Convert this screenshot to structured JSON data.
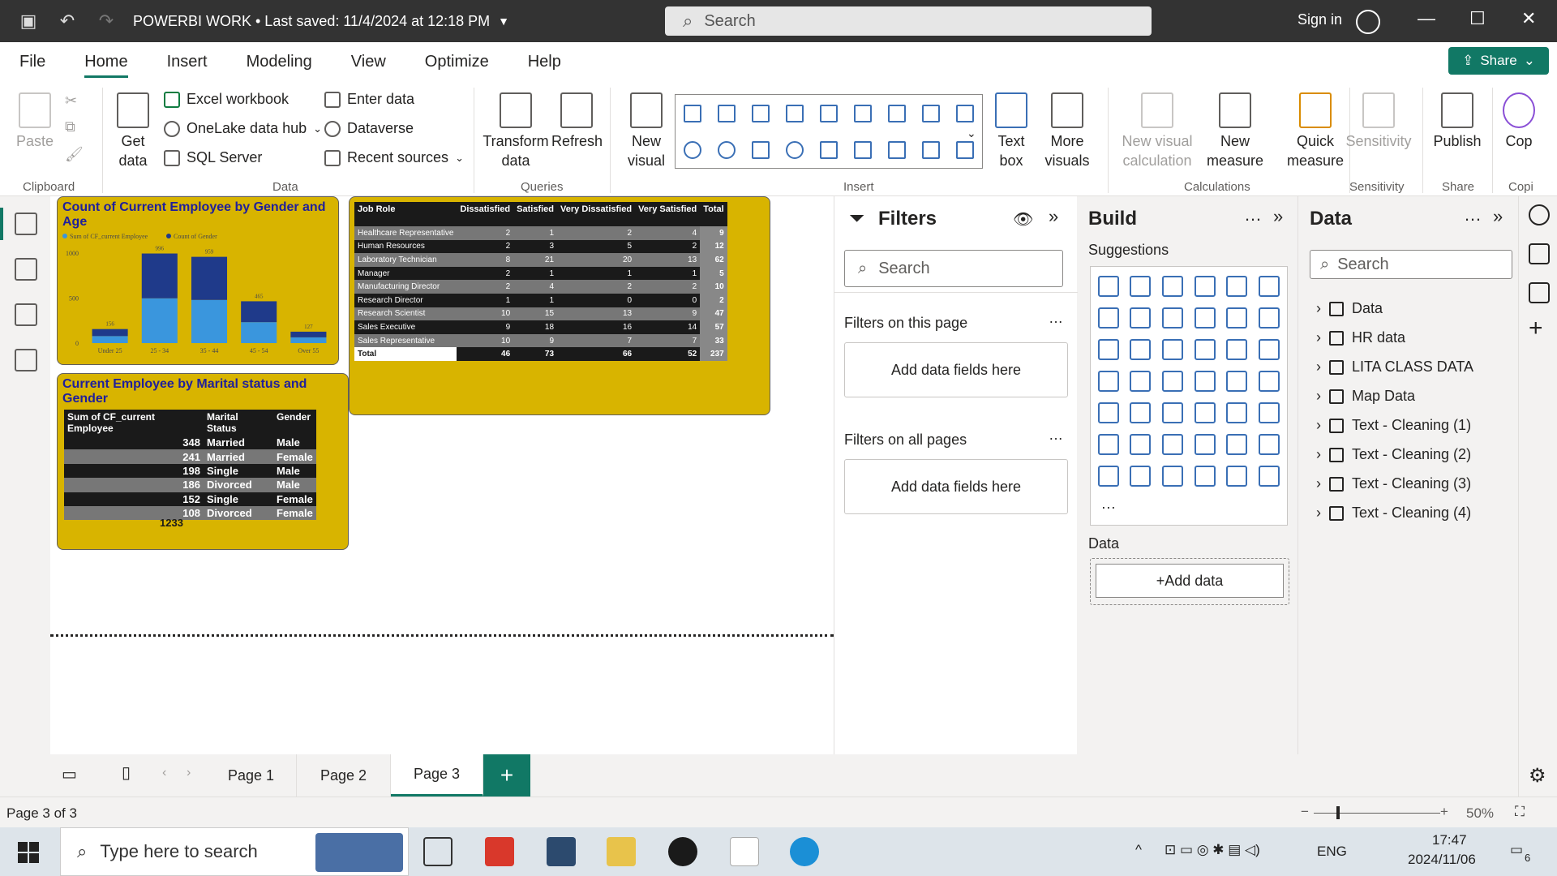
{
  "titlebar": {
    "doc_title": "POWERBI WORK • Last saved: 11/4/2024 at 12:18 PM",
    "search_placeholder": "Search",
    "signin": "Sign in"
  },
  "menu": [
    "File",
    "Home",
    "Insert",
    "Modeling",
    "View",
    "Optimize",
    "Help"
  ],
  "share_label": "Share",
  "ribbon": {
    "clipboard": {
      "label": "Clipboard",
      "paste": "Paste"
    },
    "data": {
      "label": "Data",
      "get_data": "Get data",
      "excel": "Excel workbook",
      "onelake": "OneLake data hub",
      "sql": "SQL Server",
      "enter": "Enter data",
      "dataverse": "Dataverse",
      "recent": "Recent sources"
    },
    "queries": {
      "label": "Queries",
      "transform": "Transform data",
      "refresh": "Refresh"
    },
    "insert": {
      "label": "Insert",
      "new_visual": "New visual",
      "text_box": "Text box",
      "more_visuals": "More visuals"
    },
    "calculations": {
      "label": "Calculations",
      "new_visual_calc": "New visual calculation",
      "new_measure": "New measure",
      "quick_measure": "Quick measure"
    },
    "sensitivity": {
      "label": "Sensitivity",
      "btn": "Sensitivity"
    },
    "share": {
      "label": "Share",
      "publish": "Publish"
    },
    "copilot": {
      "label": "Copi",
      "btn": "Cop"
    }
  },
  "visual1": {
    "title": "Count of Current Employee by Gender and Age",
    "legend": [
      "Sum of CF_current Employee",
      "Count of Gender"
    ]
  },
  "chart_data": {
    "type": "bar",
    "title": "Count of Current Employee by Gender and Age",
    "categories": [
      "Under 25",
      "25 - 34",
      "35 - 44",
      "45 - 54",
      "Over 55"
    ],
    "data_labels": [
      156,
      996,
      959,
      465,
      127
    ],
    "series": [
      {
        "name": "Sum of CF_current Employee",
        "color": "#3a96dd",
        "values": [
          78,
          498,
          480,
          233,
          64
        ]
      },
      {
        "name": "Count of Gender",
        "color": "#1f3a8a",
        "values": [
          78,
          498,
          479,
          232,
          63
        ]
      }
    ],
    "yticks": [
      0,
      500,
      1000
    ],
    "ylim": [
      0,
      1100
    ],
    "stacked": true
  },
  "matrix": {
    "headers": [
      "Job Role",
      "Dissatisfied",
      "Satisfied",
      "Very Dissatisfied",
      "Very Satisfied",
      "Total"
    ],
    "rows": [
      [
        "Healthcare Representative",
        "2",
        "1",
        "2",
        "4",
        "9"
      ],
      [
        "Human Resources",
        "2",
        "3",
        "5",
        "2",
        "12"
      ],
      [
        "Laboratory Technician",
        "8",
        "21",
        "20",
        "13",
        "62"
      ],
      [
        "Manager",
        "2",
        "1",
        "1",
        "1",
        "5"
      ],
      [
        "Manufacturing Director",
        "2",
        "4",
        "2",
        "2",
        "10"
      ],
      [
        "Research Director",
        "1",
        "1",
        "0",
        "0",
        "2"
      ],
      [
        "Research Scientist",
        "10",
        "15",
        "13",
        "9",
        "47"
      ],
      [
        "Sales Executive",
        "9",
        "18",
        "16",
        "14",
        "57"
      ],
      [
        "Sales Representative",
        "10",
        "9",
        "7",
        "7",
        "33"
      ]
    ],
    "total": [
      "Total",
      "46",
      "73",
      "66",
      "52",
      "237"
    ]
  },
  "marital": {
    "title": "Current Employee by Marital status and Gender",
    "headers": [
      "Sum of CF_current Employee",
      "Marital Status",
      "Gender"
    ],
    "rows": [
      [
        "348",
        "Married",
        "Male"
      ],
      [
        "241",
        "Married",
        "Female"
      ],
      [
        "198",
        "Single",
        "Male"
      ],
      [
        "186",
        "Divorced",
        "Male"
      ],
      [
        "152",
        "Single",
        "Female"
      ],
      [
        "108",
        "Divorced",
        "Female"
      ]
    ],
    "total": "1233"
  },
  "filters": {
    "title": "Filters",
    "search": "Search",
    "on_page": "Filters on this page",
    "on_all": "Filters on all pages",
    "drop": "Add data fields here"
  },
  "build": {
    "title": "Build",
    "suggestions": "Suggestions",
    "data_label": "Data",
    "add_data": "+Add data"
  },
  "datapane": {
    "title": "Data",
    "search": "Search",
    "tables": [
      "Data",
      "HR data",
      "LITA CLASS DATA",
      "Map Data",
      "Text - Cleaning (1)",
      "Text - Cleaning (2)",
      "Text - Cleaning (3)",
      "Text - Cleaning (4)"
    ]
  },
  "pages": [
    "Page 1",
    "Page 2",
    "Page 3"
  ],
  "status": {
    "page": "Page 3 of 3",
    "zoom": "50%"
  },
  "taskbar": {
    "search": "Type here to search",
    "lang": "ENG",
    "time": "17:47",
    "date": "2024/11/06",
    "notif": "6"
  }
}
